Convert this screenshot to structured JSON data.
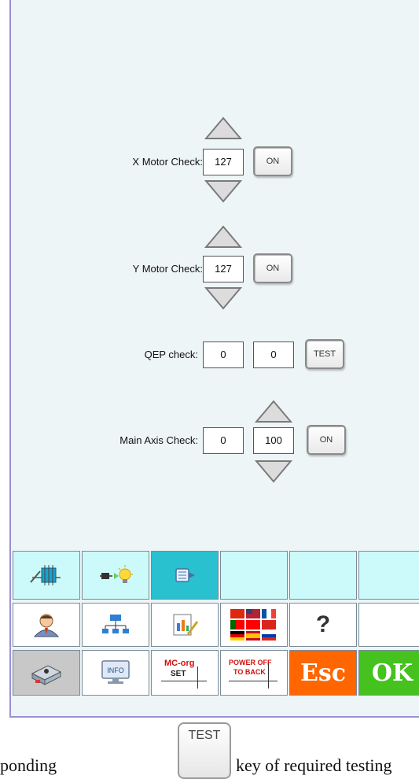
{
  "motors": {
    "x": {
      "label": "X Motor Check:",
      "value": "127",
      "button": "ON"
    },
    "y": {
      "label": "Y Motor Check:",
      "value": "127",
      "button": "ON"
    }
  },
  "qep": {
    "label": "QEP check:",
    "value1": "0",
    "value2": "0",
    "button": "TEST"
  },
  "main_axis": {
    "label": "Main Axis Check:",
    "value1": "0",
    "value2": "100",
    "button": "ON"
  },
  "toolbar": {
    "row3": {
      "mc_org_line1": "MC-org",
      "mc_org_line2": "SET",
      "power_line1": "POWER OFF",
      "power_line2": "TO BACK",
      "esc": "Esc",
      "ok": "OK",
      "info": "INFO"
    },
    "row2": {
      "help": "?"
    }
  },
  "caption": {
    "before": "ponding",
    "key": "TEST",
    "after": "key of required testing"
  },
  "colors": {
    "panel_bg": "#eef5f7",
    "border": "#9b8fd6",
    "tab_cyan": "#ccfafa",
    "tab_active": "#29c0d0",
    "esc": "#ff6600",
    "ok": "#45c21d"
  }
}
